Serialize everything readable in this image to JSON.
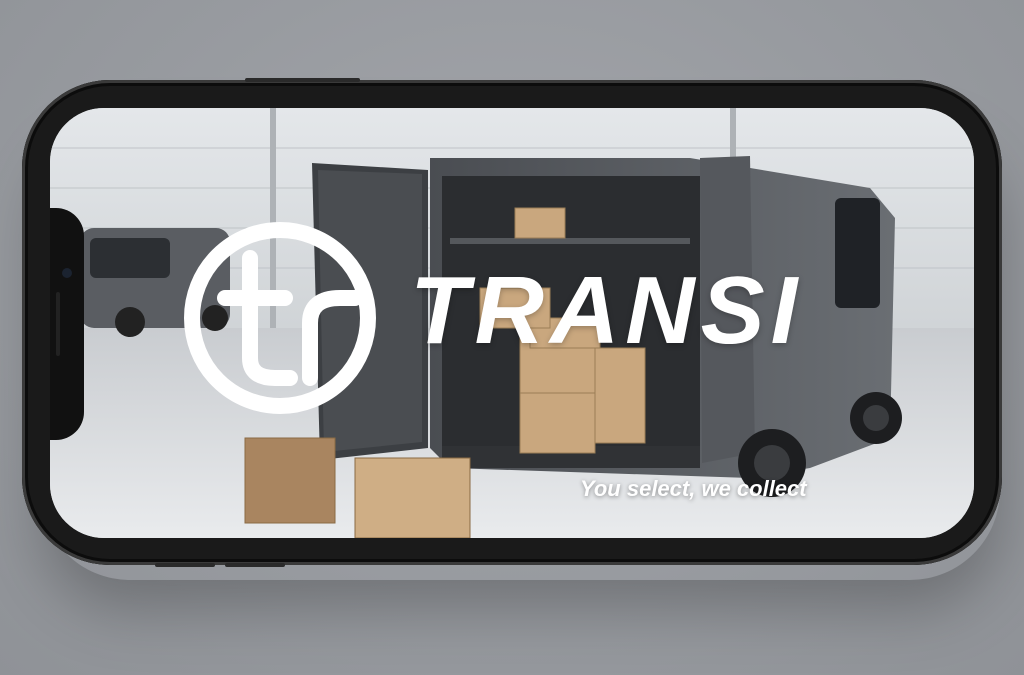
{
  "brand": {
    "name": "TRANSI",
    "tagline": "You select, we collect",
    "logo_mark": "tr"
  },
  "colors": {
    "background": "#9a9ba0",
    "phone_frame": "#1a1a1a",
    "logo": "#ffffff"
  },
  "icons": {
    "logo": "tr-circle-logo-icon"
  }
}
